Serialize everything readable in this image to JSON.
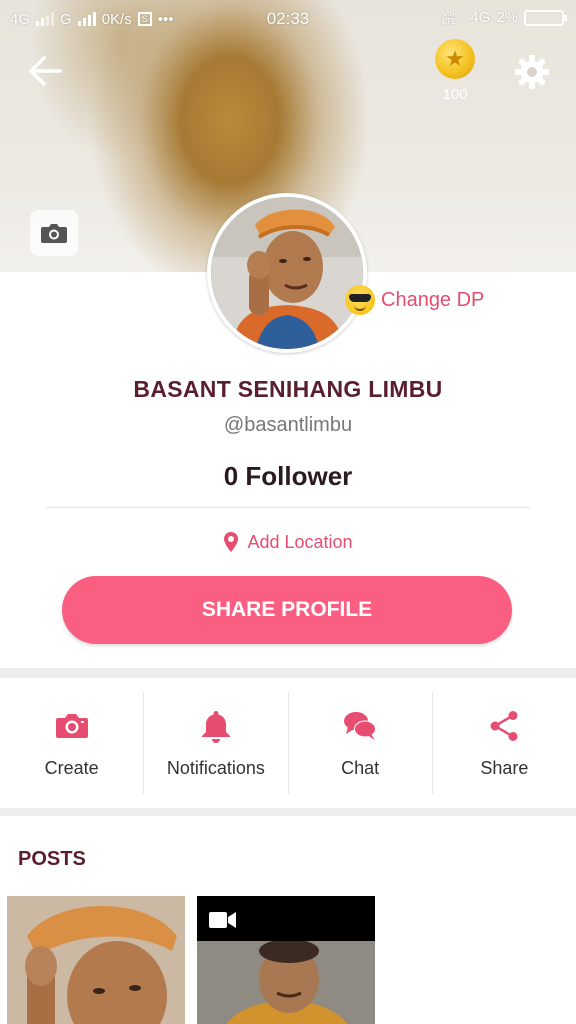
{
  "status_bar": {
    "network1": "4G",
    "network2": "G",
    "speed": "0K/s",
    "time": "02:33",
    "volte": "Vo) LTE",
    "network3": "4G",
    "battery": "2%"
  },
  "header": {
    "coin_count": "100"
  },
  "profile": {
    "change_dp_label": "Change DP",
    "name": "BASANT SENIHANG LIMBU",
    "handle": "@basantlimbu",
    "followers": "0 Follower",
    "location_label": "Add Location",
    "share_button": "SHARE PROFILE"
  },
  "actions": [
    {
      "label": "Create",
      "icon": "camera-icon"
    },
    {
      "label": "Notifications",
      "icon": "bell-icon"
    },
    {
      "label": "Chat",
      "icon": "chat-bubbles-icon"
    },
    {
      "label": "Share",
      "icon": "share-icon"
    }
  ],
  "posts": {
    "title": "POSTS"
  },
  "colors": {
    "accent": "#fa5f82",
    "accent_text": "#e74c71",
    "name_color": "#5a1f2c"
  }
}
